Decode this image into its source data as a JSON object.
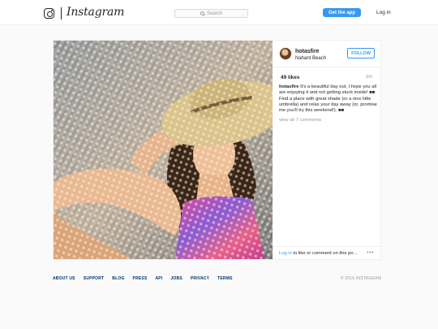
{
  "header": {
    "logo_icon": "instagram-camera-icon",
    "wordmark": "Instagram",
    "search_placeholder": "Search",
    "get_app_label": "Get the app",
    "login_label": "Log in"
  },
  "post": {
    "username": "hotasfire",
    "location": "Nahant Beach",
    "follow_label": "FOLLOW",
    "likes": "49 likes",
    "time": "1m",
    "caption_user": "hotasfire",
    "caption_text": " It's a beautiful day out, I hope you all are enjoying it and not getting stuck inside! ■■ Find a place with great shade (or a nice little umbrella) and relax your day away (or, promise me you'll try this weekend!). ■■",
    "view_all": "view all 7 comments",
    "login_link": "Log in",
    "comment_prompt": " to like or comment on this po...",
    "more_label": "•••",
    "photo_icon": "post-photo"
  },
  "footer": {
    "links": [
      "ABOUT US",
      "SUPPORT",
      "BLOG",
      "PRESS",
      "API",
      "JOBS",
      "PRIVACY",
      "TERMS"
    ],
    "copyright": "© 2016 INSTAGRAM"
  },
  "colors": {
    "accent": "#3897f0",
    "footer_link": "#003569",
    "background": "#fafafa"
  }
}
